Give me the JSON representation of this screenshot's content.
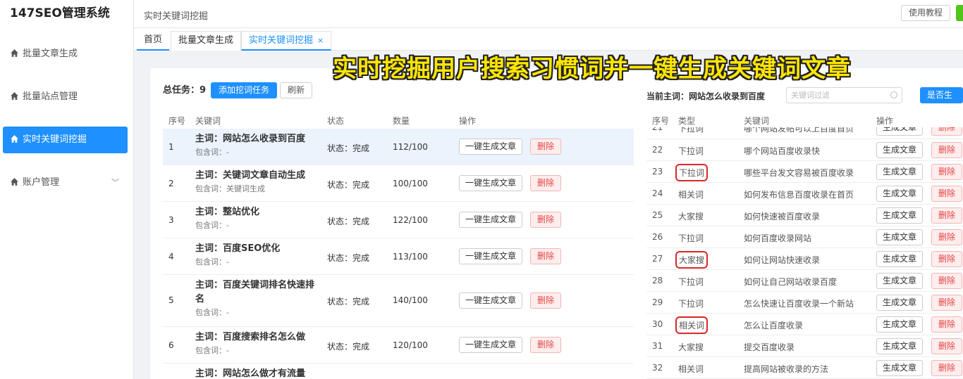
{
  "app": {
    "title": "147SEO管理系统"
  },
  "sidebar": {
    "items": [
      {
        "label": "批量文章生成"
      },
      {
        "label": "批量站点管理"
      },
      {
        "label": "实时关键词挖掘"
      },
      {
        "label": "账户管理"
      }
    ]
  },
  "topbar": {
    "breadcrumb": "实时关键词挖掘",
    "help_label": "使用教程"
  },
  "tabs": [
    {
      "label": "首页"
    },
    {
      "label": "批量文章生成"
    },
    {
      "label": "实时关键词挖掘",
      "close": "×"
    }
  ],
  "overlay_title": "实时挖掘用户搜索习惯词并一键生成关键词文章",
  "left": {
    "total_label": "总任务：",
    "total_count": "9",
    "add_button": "添加挖词任务",
    "refresh_button": "刷新",
    "columns": [
      "序号",
      "关键词",
      "状态",
      "数量",
      "操作"
    ],
    "rows": [
      {
        "no": "1",
        "main": "主词：网站怎么收录到百度",
        "sub": "包含词：-",
        "status": "状态：完成",
        "count": "112/100"
      },
      {
        "no": "2",
        "main": "主词：关键词文章自动生成",
        "sub": "包含词：关键词生成",
        "status": "状态：完成",
        "count": "100/100"
      },
      {
        "no": "3",
        "main": "主词：整站优化",
        "sub": "包含词：-",
        "status": "状态：完成",
        "count": "122/100"
      },
      {
        "no": "4",
        "main": "主词：百度SEO优化",
        "sub": "包含词：-",
        "status": "状态：完成",
        "count": "113/100"
      },
      {
        "no": "5",
        "main": "主词：百度关键词排名快速排",
        "main2": "名",
        "sub": "包含词：-",
        "status": "状态：完成",
        "count": "140/100"
      },
      {
        "no": "6",
        "main": "主词：百度搜索排名怎么做",
        "sub": "包含词：-",
        "status": "状态：完成",
        "count": "120/100"
      },
      {
        "no": "7",
        "main": "主词：网站怎么做才有流量",
        "sub": "",
        "status": "",
        "count": ""
      }
    ],
    "gen_label": "一键生成文章",
    "del_label": "删除"
  },
  "right": {
    "current_label": "当前主词：网站怎么收录到百度",
    "filter_placeholder": "关键词过滤",
    "toggle_label": "是否生成...",
    "columns": [
      "序号",
      "类型",
      "关键词",
      "操作"
    ],
    "rows": [
      {
        "no": "21",
        "type": "下拉词",
        "kw": "哪个网站发帖可以上百度首页"
      },
      {
        "no": "22",
        "type": "下拉词",
        "kw": "哪个网站百度收录快"
      },
      {
        "no": "23",
        "type": "下拉词",
        "kw": "哪些平台发文容易被百度收录",
        "hl": true
      },
      {
        "no": "24",
        "type": "相关词",
        "kw": "如何发布信息百度收录在首页"
      },
      {
        "no": "25",
        "type": "大家搜",
        "kw": "如何快速被百度收录"
      },
      {
        "no": "26",
        "type": "下拉词",
        "kw": "如何百度收录网站"
      },
      {
        "no": "27",
        "type": "大家搜",
        "kw": "如何让网站快速收录",
        "hl": true
      },
      {
        "no": "28",
        "type": "下拉词",
        "kw": "如何让自己网站收录百度"
      },
      {
        "no": "29",
        "type": "下拉词",
        "kw": "怎么快速让百度收录一个新站"
      },
      {
        "no": "30",
        "type": "相关词",
        "kw": "怎么让百度收录",
        "hl": true
      },
      {
        "no": "31",
        "type": "大家搜",
        "kw": "提交百度收录"
      },
      {
        "no": "32",
        "type": "相关词",
        "kw": "提高网站被收录的方法"
      }
    ],
    "gen_label": "生成文章",
    "del_label": "删除"
  }
}
